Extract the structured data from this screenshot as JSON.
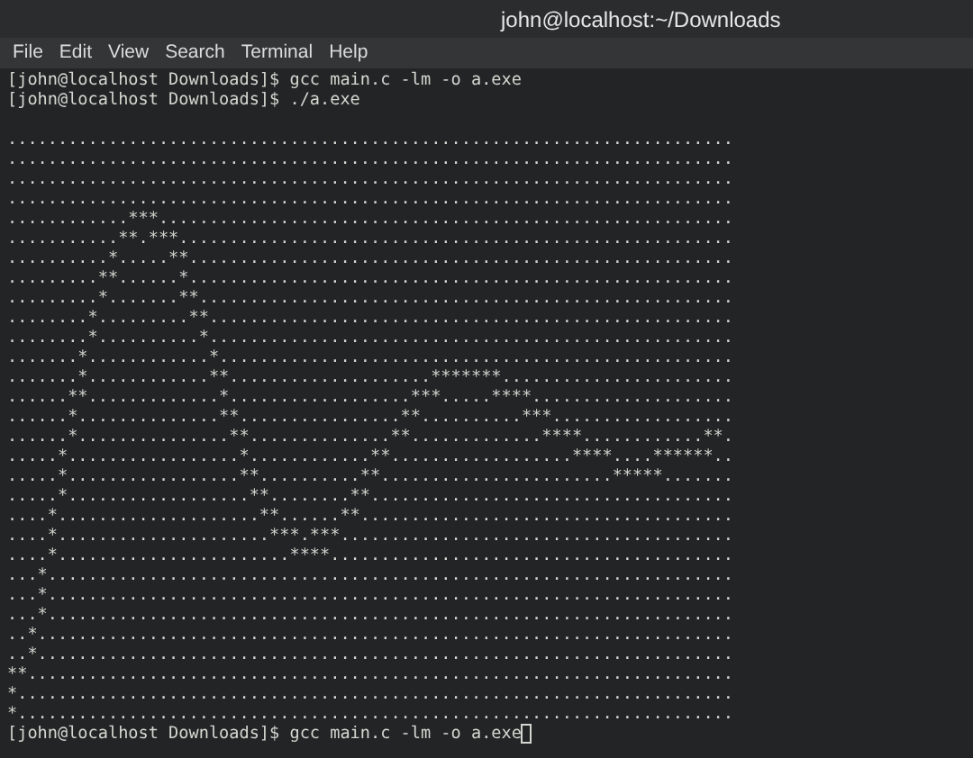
{
  "window": {
    "title": "john@localhost:~/Downloads"
  },
  "menu": [
    "File",
    "Edit",
    "View",
    "Search",
    "Terminal",
    "Help"
  ],
  "commands": [
    "[john@localhost Downloads]$ gcc main.c -lm -o a.exe",
    "[john@localhost Downloads]$ ./a.exe"
  ],
  "lines": [
    "........................................................................",
    "........................................................................",
    "........................................................................",
    "........................................................................",
    "............***.........................................................",
    "...........**.***.......................................................",
    "..........*.....**......................................................",
    ".........**......*......................................................",
    ".........*.......**.....................................................",
    "........*.........**....................................................",
    "........*..........*....................................................",
    ".......*............*...................................................",
    ".......*............**....................*******.......................",
    "......**.............*..................***.....****....................",
    "......*..............**................**..........***..................",
    "......*...............**..............**.............****............**.",
    ".....*.................*............**..................****....******..",
    ".....*.................**..........**.......................*****.......",
    ".....*..................**........**....................................",
    "....*....................**......**.....................................",
    "....*.....................***.***.......................................",
    "....*.......................****........................................",
    "...*....................................................................",
    "...*....................................................................",
    "...*....................................................................",
    "..*.....................................................................",
    "..*.....................................................................",
    "**......................................................................",
    "*.......................................................................",
    "*......................................................................."
  ],
  "prompt": "[john@localhost Downloads]$ gcc main.c -lm -o a.exe"
}
